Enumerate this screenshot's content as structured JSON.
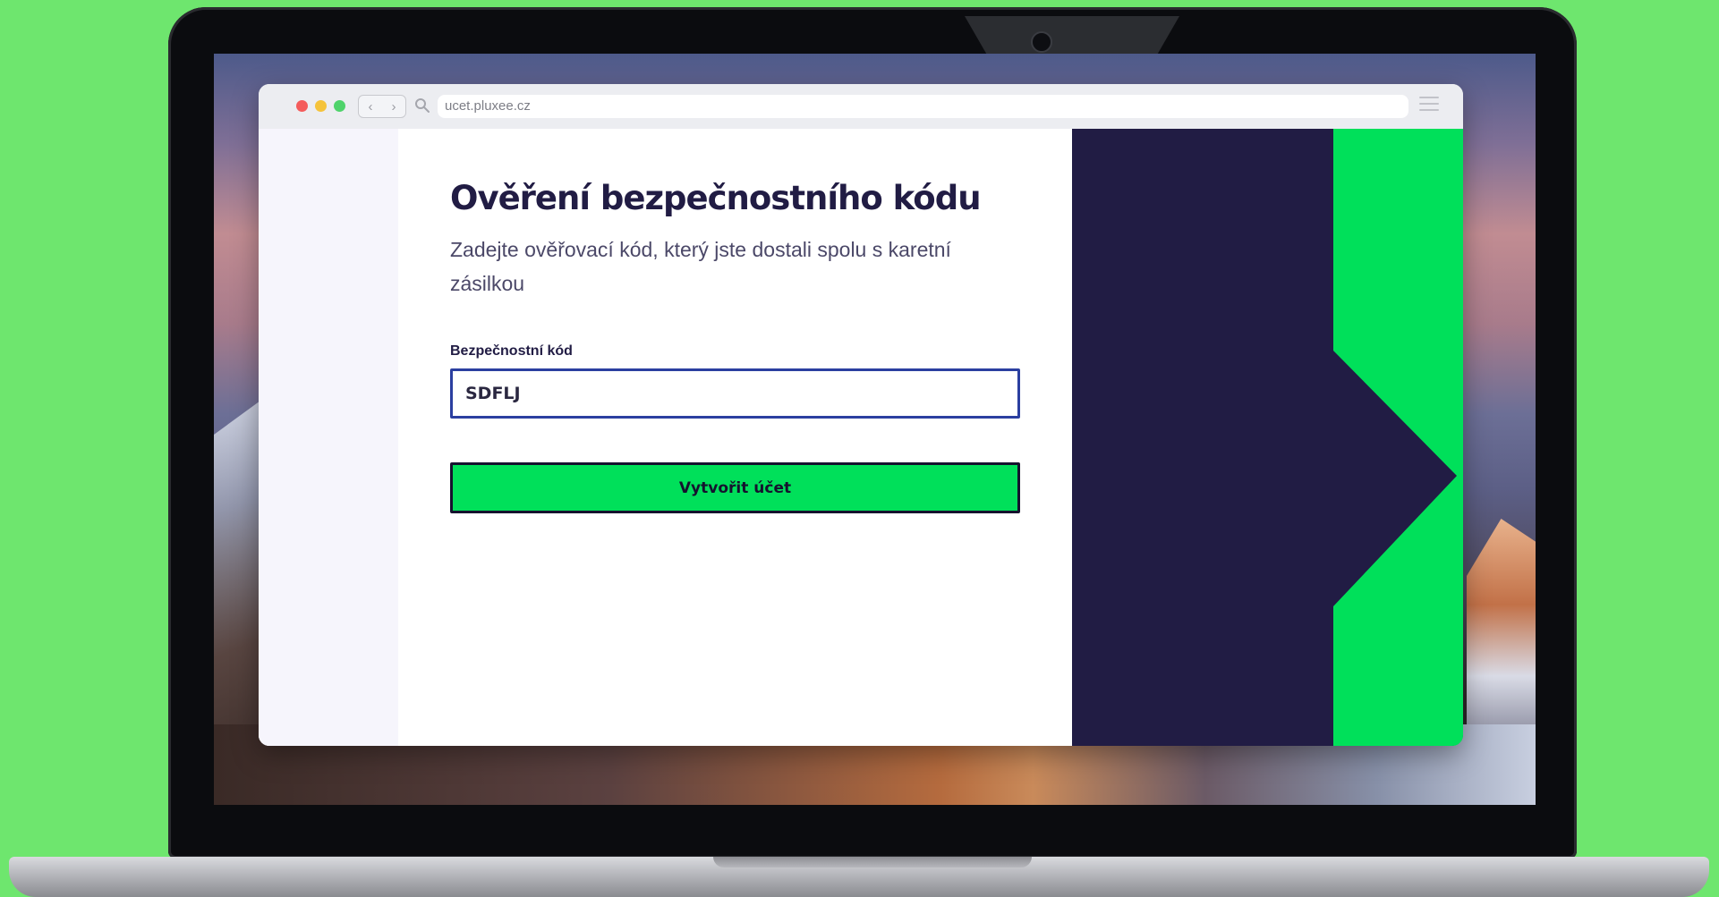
{
  "browser": {
    "url": "ucet.pluxee.cz",
    "traffic_lights": [
      "#f45c5c",
      "#f5c33b",
      "#4fd36b"
    ]
  },
  "form": {
    "title": "Ověření bezpečnostního kódu",
    "subtitle": "Zadejte ověřovací kód, který jste dostali spolu s karetní zásilkou",
    "field_label": "Bezpečnostní kód",
    "field_value": "SDFLJ",
    "submit_label": "Vytvořit účet"
  },
  "colors": {
    "background": "#6ee66e",
    "brand_navy": "#211c44",
    "brand_green": "#00e05a",
    "input_border": "#2b3fa0"
  },
  "icons": {
    "back": "chevron-left-icon",
    "forward": "chevron-right-icon",
    "search": "search-icon",
    "menu": "hamburger-menu-icon"
  }
}
